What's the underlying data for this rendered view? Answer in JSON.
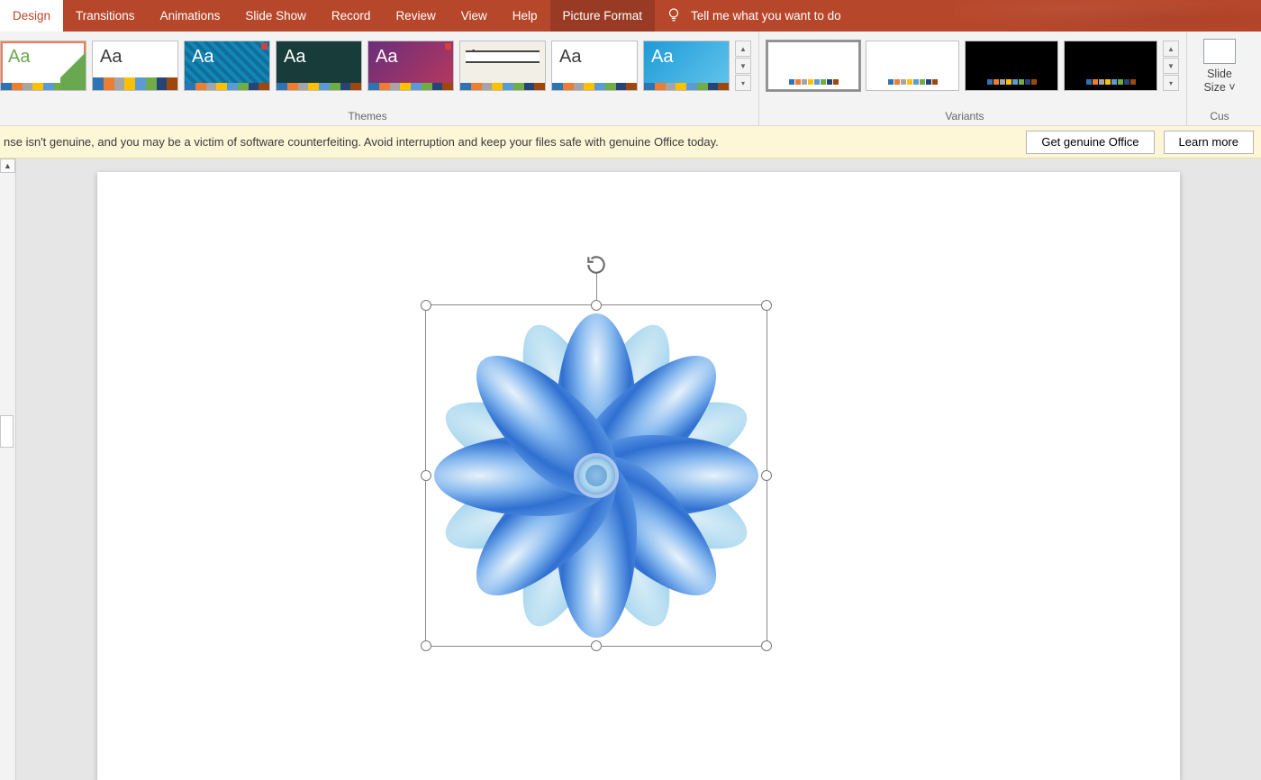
{
  "tabs": {
    "design": "Design",
    "transitions": "Transitions",
    "animations": "Animations",
    "slideshow": "Slide Show",
    "record": "Record",
    "review": "Review",
    "view": "View",
    "help": "Help",
    "picture_format": "Picture Format",
    "tellme": "Tell me what you want to do"
  },
  "ribbon": {
    "themes_label": "Themes",
    "variants_label": "Variants",
    "customize_label": "Cus",
    "slide_size_line1": "Slide",
    "slide_size_line2": "Size ˅",
    "aa": "Aa",
    "themes": [
      {
        "bg": "#ffffff",
        "fg": "#6aa84f",
        "accent_right": true,
        "selected": true
      },
      {
        "bg": "#ffffff",
        "fg": "#3b3b3b",
        "wood_footer": true
      },
      {
        "bg": "#1486b8",
        "fg": "#ffffff",
        "pattern": true,
        "pinned": true
      },
      {
        "bg": "#173c3a",
        "fg": "#ffffff"
      },
      {
        "bg": "#6a2e7a",
        "fg": "#ffffff",
        "grad": "#b8385e",
        "pinned": true
      },
      {
        "bg": "#f2efe6",
        "fg": "#5a4a32",
        "banner": true
      },
      {
        "bg": "#ffffff",
        "fg": "#3b3b3b"
      },
      {
        "bg": "#1e9bd7",
        "fg": "#ffffff",
        "grad": "#63c5ec"
      }
    ],
    "variants": [
      {
        "dark": false,
        "selected": true
      },
      {
        "dark": false
      },
      {
        "dark": true
      },
      {
        "dark": true
      }
    ]
  },
  "notice": {
    "message": "nse isn't genuine, and you may be a victim of software counterfeiting. Avoid interruption and keep your files safe with genuine Office today.",
    "btn_genuine": "Get genuine Office",
    "btn_learn": "Learn more"
  }
}
